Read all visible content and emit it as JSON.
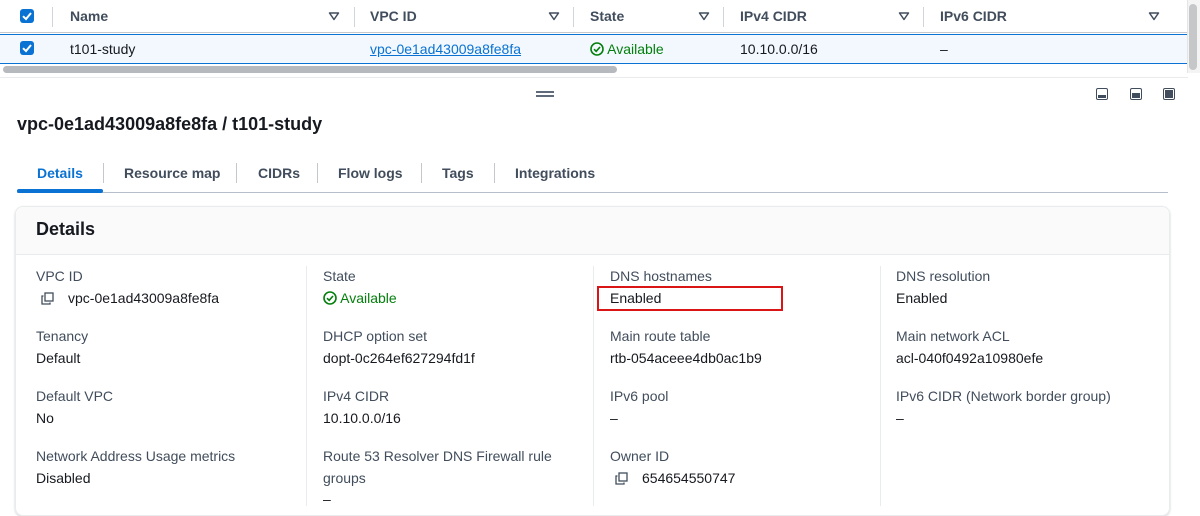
{
  "table": {
    "columns": [
      "Name",
      "VPC ID",
      "State",
      "IPv4 CIDR",
      "IPv6 CIDR"
    ],
    "row": {
      "name": "t101-study",
      "vpc_id": "vpc-0e1ad43009a8fe8fa",
      "state": "Available",
      "ipv4_cidr": "10.10.0.0/16",
      "ipv6_cidr": "–"
    }
  },
  "title": "vpc-0e1ad43009a8fe8fa / t101-study",
  "tabs": [
    "Details",
    "Resource map",
    "CIDRs",
    "Flow logs",
    "Tags",
    "Integrations"
  ],
  "details": {
    "heading": "Details",
    "col1": [
      {
        "label": "VPC ID",
        "value": "vpc-0e1ad43009a8fe8fa"
      },
      {
        "label": "Tenancy",
        "value": "Default"
      },
      {
        "label": "Default VPC",
        "value": "No"
      },
      {
        "label": "Network Address Usage metrics",
        "value": "Disabled"
      }
    ],
    "col2": [
      {
        "label": "State",
        "value": "Available"
      },
      {
        "label": "DHCP option set",
        "value": "dopt-0c264ef627294fd1f"
      },
      {
        "label": "IPv4 CIDR",
        "value": "10.10.0.0/16"
      },
      {
        "label_line1": "Route 53 Resolver DNS Firewall rule",
        "label_line2": "groups",
        "value": "–"
      }
    ],
    "col3": [
      {
        "label": "DNS hostnames",
        "value": "Enabled"
      },
      {
        "label": "Main route table",
        "value": "rtb-054aceee4db0ac1b9"
      },
      {
        "label": "IPv6 pool",
        "value": "–"
      },
      {
        "label": "Owner ID",
        "value": "654654550747"
      }
    ],
    "col4": [
      {
        "label": "DNS resolution",
        "value": "Enabled"
      },
      {
        "label": "Main network ACL",
        "value": "acl-040f0492a10980efe"
      },
      {
        "label": "IPv6 CIDR (Network border group)",
        "value": "–"
      }
    ]
  },
  "colors": {
    "accent": "#0972d3",
    "success": "#037f0c",
    "highlight": "#d91515"
  },
  "icons": [
    "checkbox-checked-icon",
    "sort-caret-icon",
    "status-available-icon",
    "copy-icon",
    "drag-handle-icon",
    "pane-layout-icon"
  ]
}
